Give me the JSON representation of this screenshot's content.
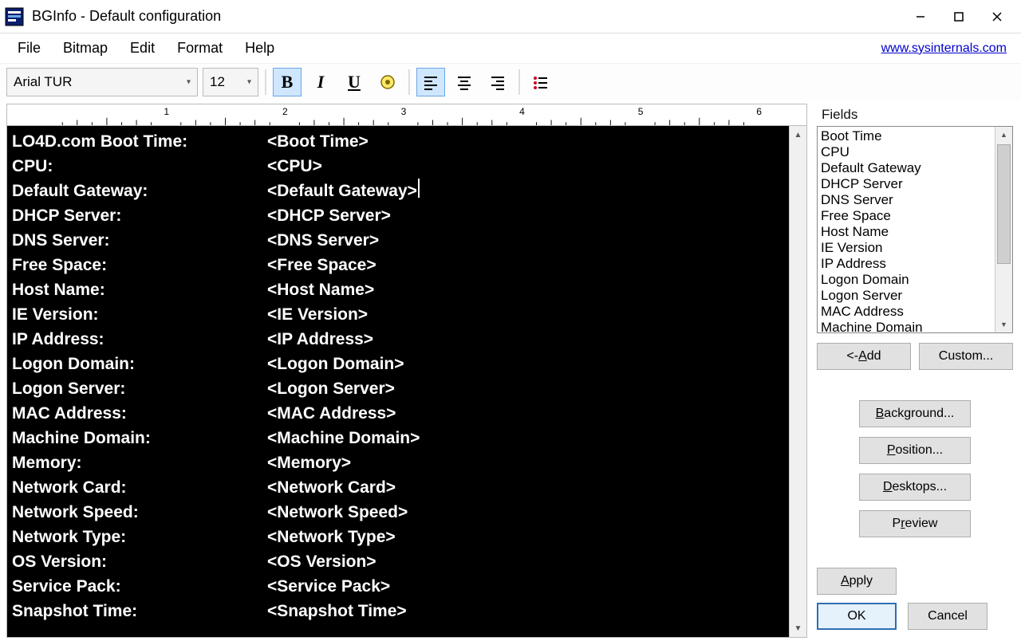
{
  "window": {
    "title": "BGInfo - Default configuration",
    "link": "www.sysinternals.com"
  },
  "menu": {
    "file": "File",
    "bitmap": "Bitmap",
    "edit": "Edit",
    "format": "Format",
    "help": "Help"
  },
  "toolbar": {
    "font": "Arial TUR",
    "size": "12"
  },
  "editor_rows": [
    {
      "label": "LO4D.com Boot Time:",
      "value": "<Boot Time>"
    },
    {
      "label": "CPU:",
      "value": "<CPU>"
    },
    {
      "label": "Default Gateway:",
      "value": "<Default Gateway>",
      "cursor": true
    },
    {
      "label": "DHCP Server:",
      "value": "<DHCP Server>"
    },
    {
      "label": "DNS Server:",
      "value": "<DNS Server>"
    },
    {
      "label": "Free Space:",
      "value": "<Free Space>"
    },
    {
      "label": "Host Name:",
      "value": "<Host Name>"
    },
    {
      "label": "IE Version:",
      "value": "<IE Version>"
    },
    {
      "label": "IP Address:",
      "value": "<IP Address>"
    },
    {
      "label": "Logon Domain:",
      "value": "<Logon Domain>"
    },
    {
      "label": "Logon Server:",
      "value": "<Logon Server>"
    },
    {
      "label": "MAC Address:",
      "value": "<MAC Address>"
    },
    {
      "label": "Machine Domain:",
      "value": "<Machine Domain>"
    },
    {
      "label": "Memory:",
      "value": "<Memory>"
    },
    {
      "label": "Network Card:",
      "value": "<Network Card>"
    },
    {
      "label": "Network Speed:",
      "value": "<Network Speed>"
    },
    {
      "label": "Network Type:",
      "value": "<Network Type>"
    },
    {
      "label": "OS Version:",
      "value": "<OS Version>"
    },
    {
      "label": "Service Pack:",
      "value": "<Service Pack>"
    },
    {
      "label": "Snapshot Time:",
      "value": "<Snapshot Time>"
    }
  ],
  "fields": {
    "title": "Fields",
    "items": [
      "Boot Time",
      "CPU",
      "Default Gateway",
      "DHCP Server",
      "DNS Server",
      "Free Space",
      "Host Name",
      "IE Version",
      "IP Address",
      "Logon Domain",
      "Logon Server",
      "MAC Address",
      "Machine Domain"
    ]
  },
  "buttons": {
    "add_prefix": "<- ",
    "add_u": "A",
    "add_rest": "dd",
    "custom": "Custom...",
    "background": "Background...",
    "background_u": "B",
    "position": "Position...",
    "position_u": "P",
    "desktops": "Desktops...",
    "desktops_u": "D",
    "preview": "Preview",
    "preview_u": "r",
    "apply": "Apply",
    "apply_u": "A",
    "ok": "OK",
    "cancel": "Cancel"
  },
  "ruler_numbers": [
    1,
    2,
    3,
    4,
    5,
    6
  ]
}
